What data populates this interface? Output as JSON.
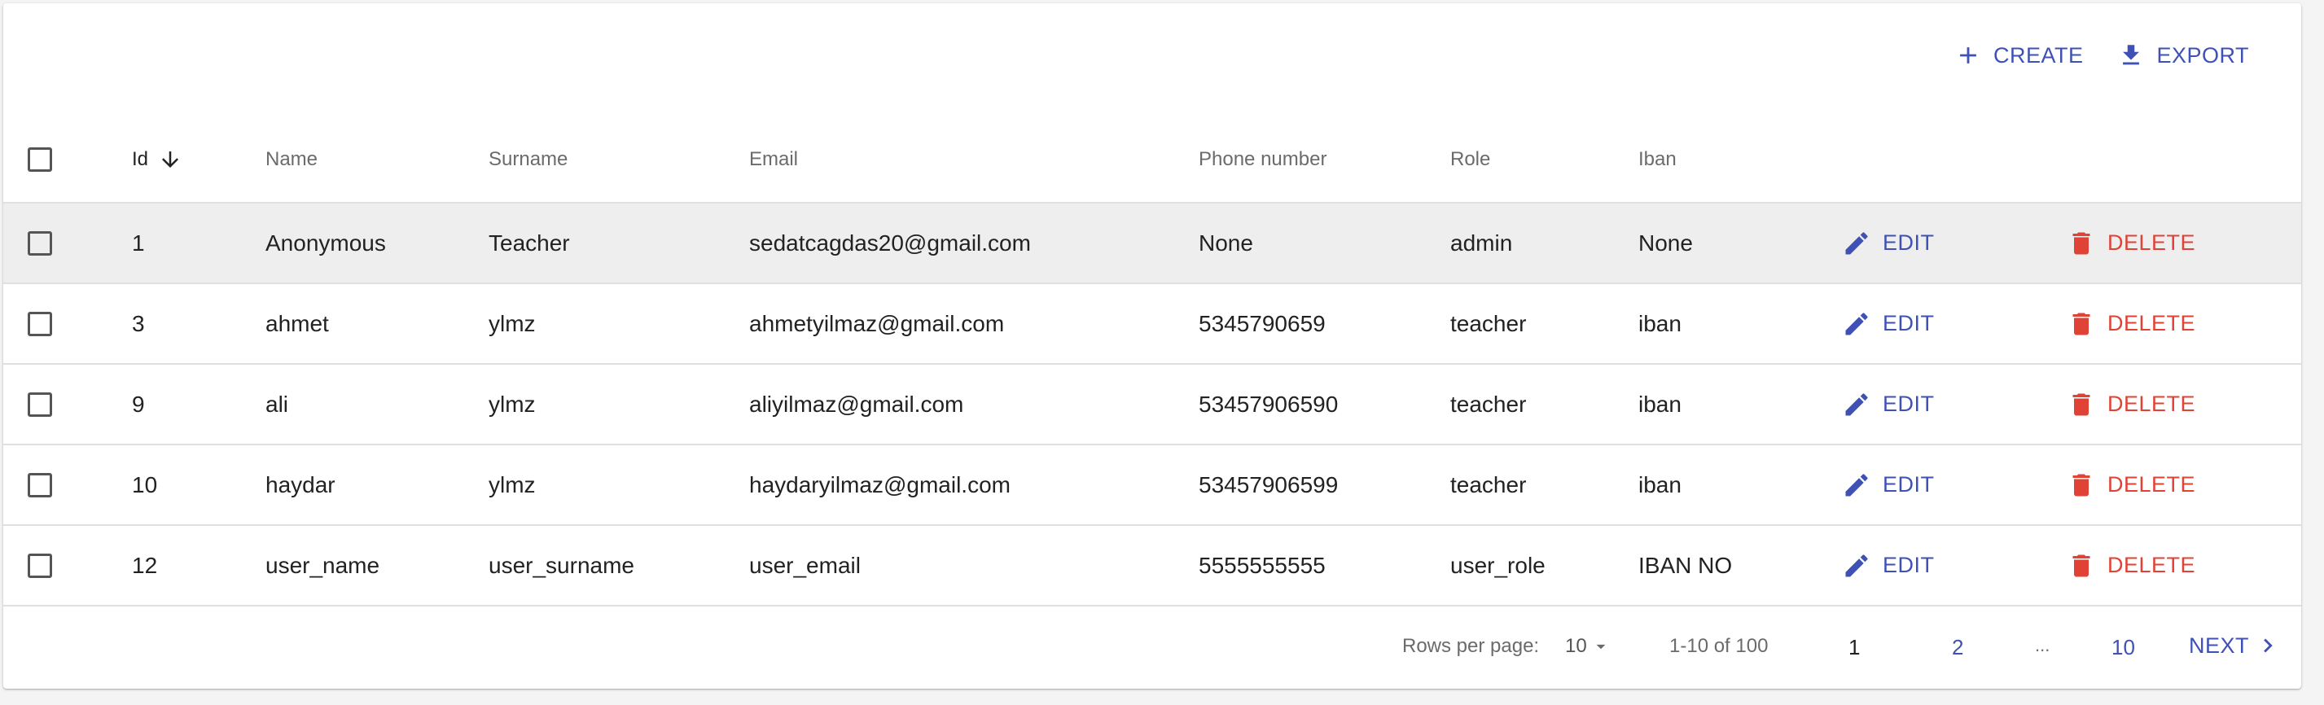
{
  "toolbar": {
    "create_label": "CREATE",
    "export_label": "EXPORT"
  },
  "table": {
    "headers": {
      "id": "Id",
      "name": "Name",
      "surname": "Surname",
      "email": "Email",
      "phone": "Phone number",
      "role": "Role",
      "iban": "Iban"
    },
    "rows": [
      {
        "id": "1",
        "name": "Anonymous",
        "surname": "Teacher",
        "email": "sedatcagdas20@gmail.com",
        "phone": "None",
        "role": "admin",
        "iban": "None"
      },
      {
        "id": "3",
        "name": "ahmet",
        "surname": "ylmz",
        "email": "ahmetyilmaz@gmail.com",
        "phone": "5345790659",
        "role": "teacher",
        "iban": "iban"
      },
      {
        "id": "9",
        "name": "ali",
        "surname": "ylmz",
        "email": "aliyilmaz@gmail.com",
        "phone": "53457906590",
        "role": "teacher",
        "iban": "iban"
      },
      {
        "id": "10",
        "name": "haydar",
        "surname": "ylmz",
        "email": "haydaryilmaz@gmail.com",
        "phone": "53457906599",
        "role": "teacher",
        "iban": "iban"
      },
      {
        "id": "12",
        "name": "user_name",
        "surname": "user_surname",
        "email": "user_email",
        "phone": "5555555555",
        "role": "user_role",
        "iban": "IBAN NO"
      }
    ],
    "edit_label": "EDIT",
    "delete_label": "DELETE"
  },
  "pagination": {
    "rows_per_page_label": "Rows per page:",
    "rows_per_page_value": "10",
    "range_text": "1-10 of 100",
    "pages": [
      "1",
      "2",
      "...",
      "10"
    ],
    "next_label": "NEXT"
  },
  "colors": {
    "primary": "#3f51b5",
    "danger": "#e04335",
    "hover_row": "#eeeeee"
  },
  "icons": {
    "create": "plus-icon",
    "export": "download-icon",
    "sort": "arrow-down-icon",
    "edit": "pencil-icon",
    "delete": "trash-icon",
    "dropdown": "caret-down-icon",
    "next": "chevron-right-icon"
  }
}
